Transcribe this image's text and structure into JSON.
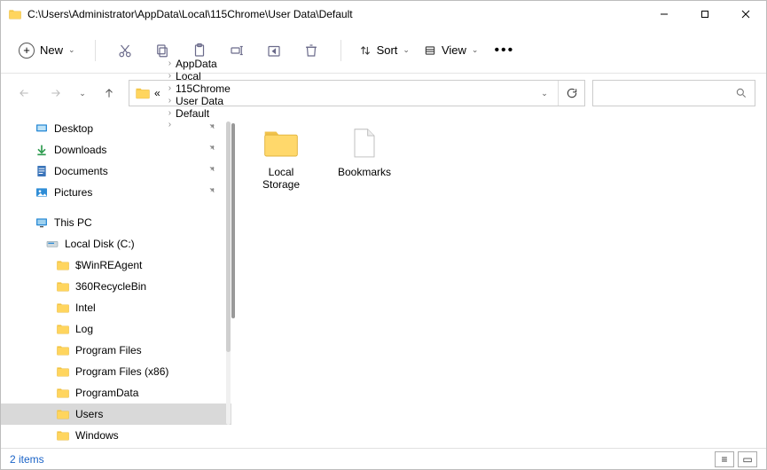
{
  "window": {
    "title": "C:\\Users\\Administrator\\AppData\\Local\\115Chrome\\User Data\\Default"
  },
  "ribbon": {
    "new_label": "New",
    "sort_label": "Sort",
    "view_label": "View"
  },
  "breadcrumbs": {
    "overflow": "«",
    "parts": [
      "AppData",
      "Local",
      "115Chrome",
      "User Data",
      "Default"
    ]
  },
  "sidebar": {
    "quick": [
      {
        "label": "Desktop",
        "icon": "desktop",
        "pinned": true
      },
      {
        "label": "Downloads",
        "icon": "download",
        "pinned": true
      },
      {
        "label": "Documents",
        "icon": "document",
        "pinned": true
      },
      {
        "label": "Pictures",
        "icon": "picture",
        "pinned": true
      }
    ],
    "thispc_label": "This PC",
    "drive_label": "Local Disk (C:)",
    "folders": [
      "$WinREAgent",
      "360RecycleBin",
      "Intel",
      "Log",
      "Program Files",
      "Program Files (x86)",
      "ProgramData",
      "Users",
      "Windows"
    ],
    "selected": "Users"
  },
  "content": {
    "items": [
      {
        "name": "Local Storage",
        "type": "folder"
      },
      {
        "name": "Bookmarks",
        "type": "file"
      }
    ]
  },
  "status": {
    "count_label": "2 items"
  }
}
